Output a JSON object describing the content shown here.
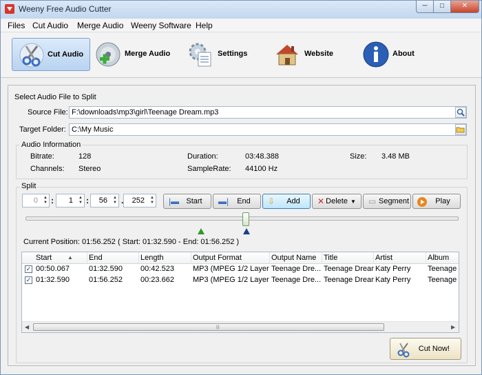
{
  "window": {
    "title": "Weeny Free Audio Cutter",
    "minimize": "─",
    "maximize": "□",
    "close": "✕"
  },
  "menu": [
    "Files",
    "Cut Audio",
    "Merge Audio",
    "Weeny Software",
    "Help"
  ],
  "toolbar": {
    "cut_audio": "Cut Audio",
    "merge_audio": "Merge Audio",
    "settings": "Settings",
    "website": "Website",
    "about": "About"
  },
  "select": {
    "heading": "Select Audio File to Split",
    "source_label": "Source File:",
    "source_value": "F:\\downloads\\mp3\\girl\\Teenage Dream.mp3",
    "target_label": "Target Folder:",
    "target_value": "C:\\My Music"
  },
  "audio_info": {
    "title": "Audio Information",
    "bitrate_label": "Bitrate:",
    "bitrate_value": "128",
    "duration_label": "Duration:",
    "duration_value": "03:48.388",
    "size_label": "Size:",
    "size_value": "3.48 MB",
    "channels_label": "Channels:",
    "channels_value": "Stereo",
    "samplerate_label": "SampleRate:",
    "samplerate_value": "44100 Hz"
  },
  "split": {
    "title": "Split",
    "hours": "0",
    "minutes": "1",
    "seconds": "56",
    "millis": "252",
    "sep_colon": ":",
    "sep_dot": ".",
    "start_btn": "Start",
    "end_btn": "End",
    "add_btn": "Add",
    "delete_btn": "Delete",
    "segment_btn": "Segment",
    "play_btn": "Play",
    "slider_position": 0.51,
    "current_position": "Current Position: 01:56.252 ( Start: 01:32.590 - End: 01:56.252 )"
  },
  "segments": {
    "columns": [
      "Start",
      "End",
      "Length",
      "Output Format",
      "Output Name",
      "Title",
      "Artist",
      "Album"
    ],
    "rows": [
      {
        "start": "00:50.067",
        "end": "01:32.590",
        "length": "00:42.523",
        "format": "MP3 (MPEG 1/2 Layer 3)",
        "name": "Teenage Dre...",
        "title": "Teenage Dream",
        "artist": "Katy Perry",
        "album": "Teenage D"
      },
      {
        "start": "01:32.590",
        "end": "01:56.252",
        "length": "00:23.662",
        "format": "MP3 (MPEG 1/2 Layer 3)",
        "name": "Teenage Dre...",
        "title": "Teenage Dream",
        "artist": "Katy Perry",
        "album": "Teenage D"
      }
    ]
  },
  "cut_now": "Cut Now!"
}
